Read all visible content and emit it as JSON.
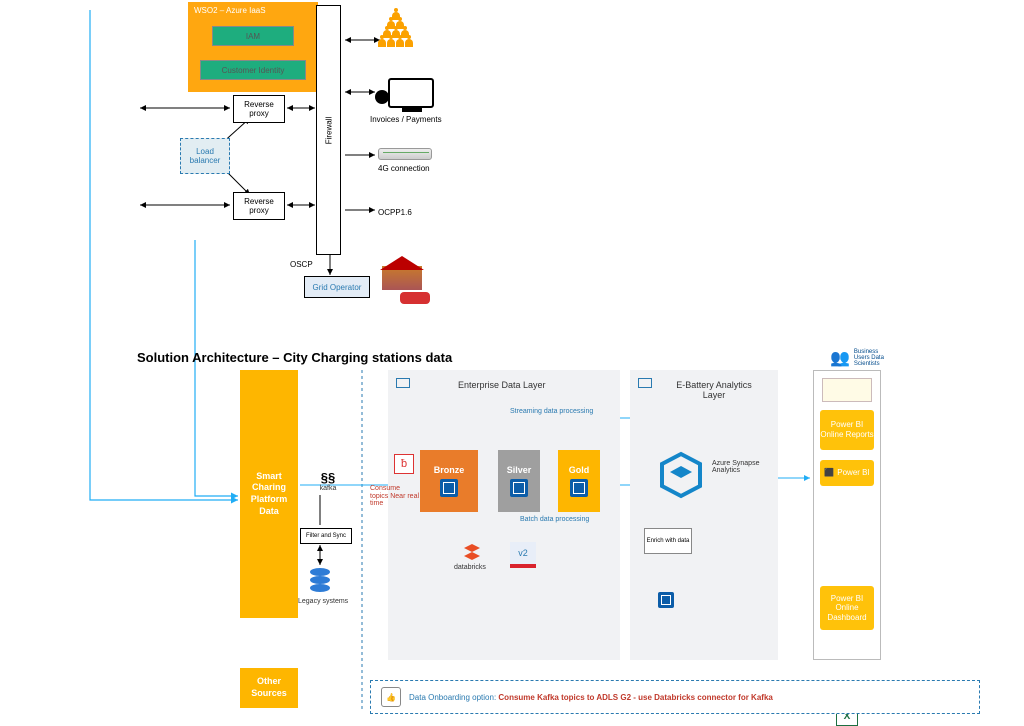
{
  "top": {
    "wso2_header": "WSO2 – Azure IaaS",
    "iam": "IAM",
    "cust_id": "Customer Identity",
    "load_balancer": "Load balancer",
    "reverse_proxy1": "Reverse proxy",
    "reverse_proxy2": "Reverse proxy",
    "firewall": "Firewall",
    "invoices": "Invoices / Payments",
    "conn4g": "4G connection",
    "ocpp": "OCPP1.6",
    "oscp": "OSCP",
    "grid_operator": "Grid Operator"
  },
  "title": "Solution Architecture – City Charging stations data",
  "sources": {
    "smart": "Smart Charing Platform Data",
    "other": "Other Sources"
  },
  "ingest": {
    "kafka": "kafka",
    "filter_sync": "Filter and Sync",
    "legacy": "Legacy systems"
  },
  "edl": {
    "title": "Enterprise Data Layer",
    "consume": "Consume topics Near real time",
    "stream": "Streaming data processing",
    "batch": "Batch data processing",
    "bronze": "Bronze",
    "silver": "Silver",
    "gold": "Gold",
    "databricks": "databricks",
    "v2": "v2"
  },
  "analytics": {
    "title": "E-Battery Analytics Layer",
    "synapse": "Azure Synapse Analytics",
    "enrich": "Enrich with data"
  },
  "consumers": {
    "biz": "Business Users Data Scientists",
    "pbi_reports": "Power BI Online Reports",
    "pbi": "Power BI",
    "pbi_dash": "Power BI Online Dashboard"
  },
  "callout": {
    "prefix": "Data Onboarding option: ",
    "bold": "Consume Kafka topics to ADLS G2 - use Databricks connector for Kafka"
  }
}
